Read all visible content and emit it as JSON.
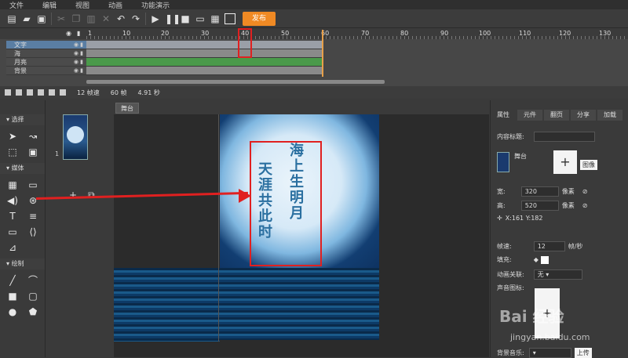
{
  "menu": [
    "文件",
    "编辑",
    "视图",
    "动画",
    "功能演示"
  ],
  "toolbar": {
    "publish_label": "发布"
  },
  "timeline": {
    "ruler": [
      "1",
      "10",
      "20",
      "30",
      "40",
      "50",
      "60",
      "70",
      "80",
      "90",
      "100",
      "110",
      "120",
      "130"
    ],
    "layers": [
      "文字",
      "海",
      "月亮",
      "背景"
    ],
    "footer": {
      "fps": "12 帧速",
      "frames": "60 帧",
      "duration": "4.91 秒"
    }
  },
  "tools": {
    "select_header": "选择",
    "media_header": "媒体",
    "draw_header": "绘制"
  },
  "thumbs": {
    "page_number": "1"
  },
  "stage": {
    "tab_label": "舞台",
    "poem_col1": "海上生明月",
    "poem_col2": "天涯共此时"
  },
  "props": {
    "tabs": [
      "属性",
      "元件",
      "翻页",
      "分享",
      "加载"
    ],
    "content_title_label": "内容标题:",
    "stage_label": "舞台",
    "image_btn": "图像",
    "width_label": "宽:",
    "width_value": "320",
    "width_unit": "像素",
    "height_label": "高:",
    "height_value": "520",
    "height_unit": "像素",
    "coords": "X:161   Y:182",
    "fps_label": "帧速:",
    "fps_value": "12",
    "fps_unit": "帧/秒",
    "fill_label": "填充:",
    "anim_label": "动画关联:",
    "anim_value": "无",
    "sound_icon_label": "声音图标:",
    "bgm_label": "背景音乐:",
    "upload_btn": "上传"
  },
  "watermark": {
    "brand": "Bai 经验",
    "url": "jingyan.baidu.com"
  }
}
